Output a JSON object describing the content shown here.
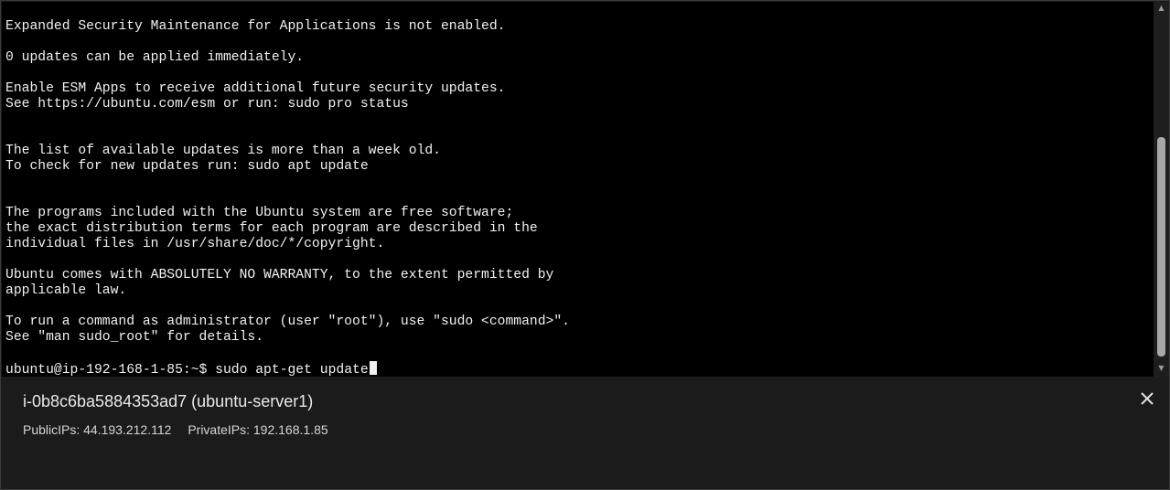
{
  "terminal": {
    "lines": [
      "Expanded Security Maintenance for Applications is not enabled.",
      "",
      "0 updates can be applied immediately.",
      "",
      "Enable ESM Apps to receive additional future security updates.",
      "See https://ubuntu.com/esm or run: sudo pro status",
      "",
      "",
      "The list of available updates is more than a week old.",
      "To check for new updates run: sudo apt update",
      "",
      "",
      "The programs included with the Ubuntu system are free software;",
      "the exact distribution terms for each program are described in the",
      "individual files in /usr/share/doc/*/copyright.",
      "",
      "Ubuntu comes with ABSOLUTELY NO WARRANTY, to the extent permitted by",
      "applicable law.",
      "",
      "To run a command as administrator (user \"root\"), use \"sudo <command>\".",
      "See \"man sudo_root\" for details.",
      ""
    ],
    "prompt": "ubuntu@ip-192-168-1-85:~$ ",
    "command": "sudo apt-get update"
  },
  "scrollbar": {
    "up_icon": "caret-up-icon",
    "down_icon": "caret-down-icon"
  },
  "instance": {
    "title": "i-0b8c6ba5884353ad7 (ubuntu-server1)",
    "public_ips": "PublicIPs: 44.193.212.112",
    "private_ips": "PrivateIPs: 192.168.1.85",
    "close_icon": "close-icon"
  }
}
